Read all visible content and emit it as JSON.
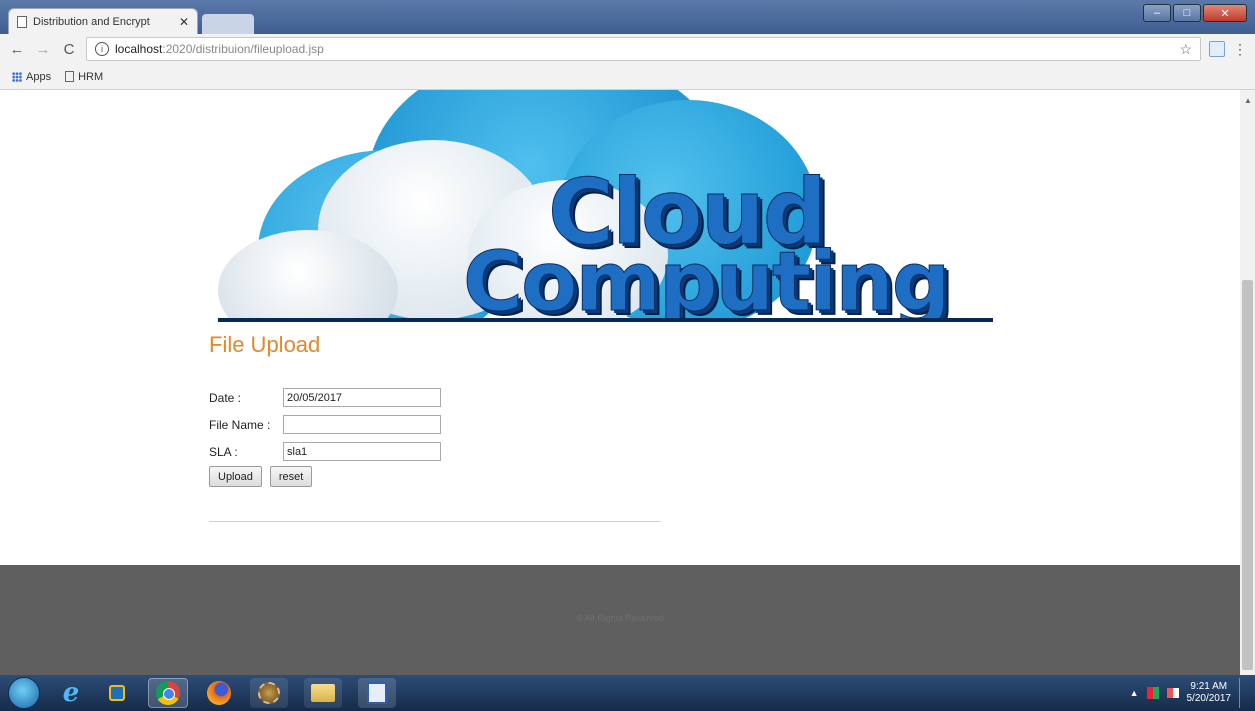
{
  "browser": {
    "tab_title": "Distribution and Encrypt",
    "tab_close": "✕",
    "url_host": "localhost",
    "url_path": ":2020/distribuion/fileupload.jsp",
    "window_controls": {
      "minimize": "–",
      "maximize": "□",
      "close": "✕"
    },
    "nav_icons": {
      "back": "←",
      "forward": "→",
      "reload": "C",
      "info": "i",
      "star": "☆",
      "menu": "⋮"
    },
    "bookmarks": [
      {
        "label": "Apps",
        "icon": "apps-grid-icon"
      },
      {
        "label": "HRM",
        "icon": "page-icon"
      }
    ]
  },
  "banner": {
    "line1": "Cloud",
    "line2": "Computing"
  },
  "page": {
    "title": "File Upload",
    "form": {
      "date_label": "Date :",
      "date_value": "20/05/2017",
      "filename_label": "File Name :",
      "filename_value": "",
      "sla_label": "SLA :",
      "sla_value": "sla1",
      "upload_button": "Upload",
      "reset_button": "reset"
    },
    "footer_text": "© All Rights Reserved"
  },
  "taskbar": {
    "apps": [
      "start-orb",
      "internet-explorer",
      "media-player",
      "chrome",
      "firefox",
      "settings-gear",
      "file-explorer",
      "document"
    ],
    "clock_time": "9:21 AM",
    "clock_date": "5/20/2017"
  }
}
